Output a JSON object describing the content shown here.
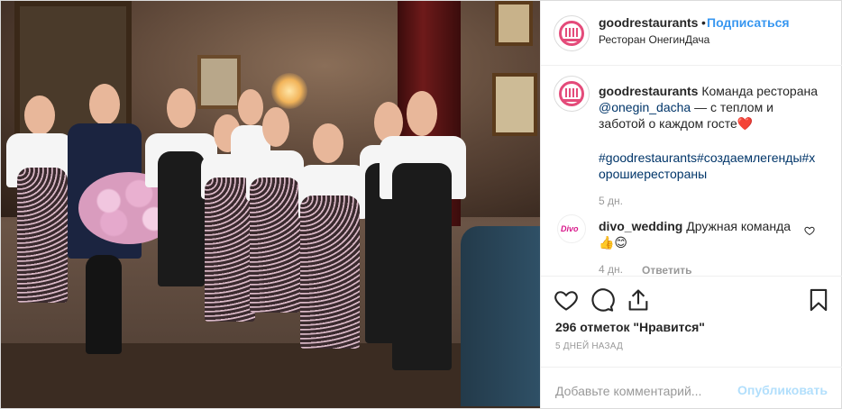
{
  "post": {
    "username": "goodrestaurants",
    "follow_label": "Подписаться",
    "separator": "•",
    "location": "Ресторан ОнегинДача"
  },
  "caption": {
    "username": "goodrestaurants",
    "text_part1": "Команда ресторана",
    "mention": "@onegin_dacha",
    "text_part2": "— с теплом и",
    "text_part3": "заботой о каждом госте",
    "emoji": "❤️",
    "hashtags_line1": "#goodrestaurants#создаемлегенды#х",
    "hashtags_line2": "орошиерестораны",
    "time": "5 дн."
  },
  "comment1": {
    "username": "divo_wedding",
    "avatar_text": "Divo",
    "text": "Дружная команда",
    "emoji": "👍😊",
    "time": "4 дн.",
    "reply_label": "Ответить"
  },
  "stats": {
    "likes": "296 отметок \"Нравится\"",
    "date": "5 ДНЕЙ НАЗАД"
  },
  "comment_box": {
    "placeholder": "Добавьте комментарий...",
    "publish_label": "Опубликовать"
  },
  "icons": {
    "like": "heart-icon",
    "comment": "comment-icon",
    "share": "share-icon",
    "save": "bookmark-icon",
    "comment_like": "small-heart-icon"
  },
  "colors": {
    "link_blue": "#3897f0",
    "mention_blue": "#003569",
    "muted": "#999999",
    "publish_disabled": "#b2dffc",
    "brand_pink": "#e44b7a"
  }
}
